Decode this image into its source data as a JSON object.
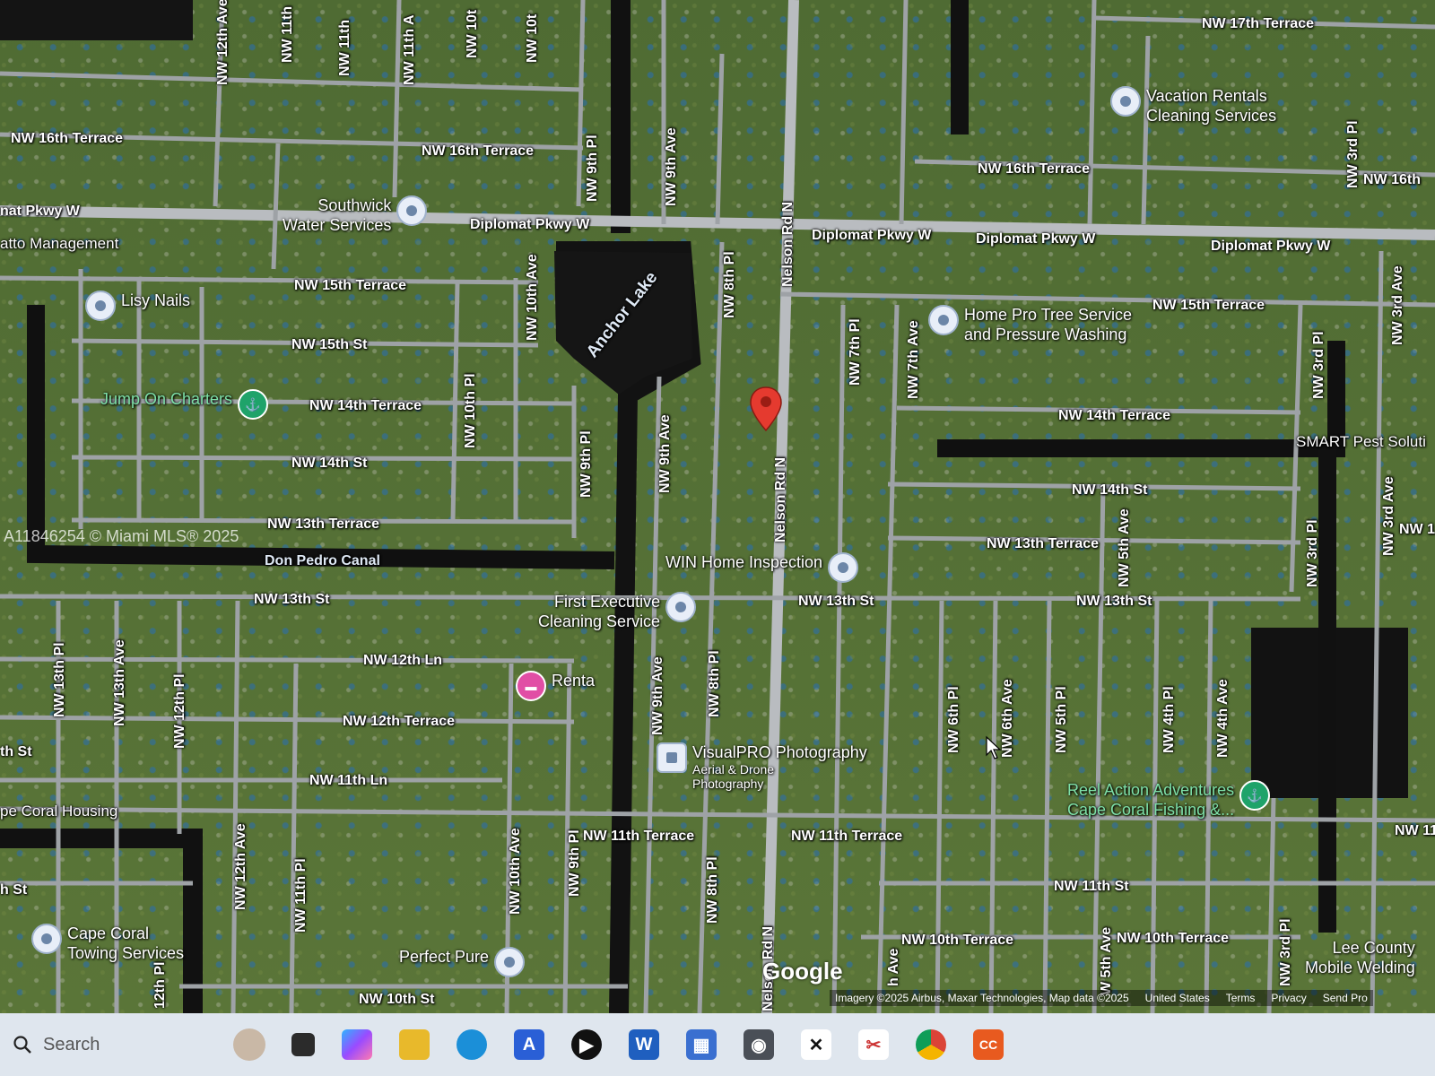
{
  "map": {
    "water": [
      {
        "name": "anchor-lake-label",
        "text": "Anchor Lake"
      },
      {
        "name": "don-pedro-canal-label",
        "text": "Don Pedro Canal"
      }
    ],
    "streets_h": [
      "NW 17th Terrace",
      "NW 16th Terrace",
      "NW 16th Terrace",
      "NW 16th Terrace",
      "NW 16th",
      "nat Pkwy W",
      "Diplomat Pkwy W",
      "Diplomat Pkwy W",
      "Diplomat Pkwy W",
      "Diplomat Pkwy W",
      "NW 15th Terrace",
      "NW 15th Terrace",
      "NW 15th St",
      "NW 14th Terrace",
      "NW 14th Terrace",
      "NW 14th St",
      "NW 14th St",
      "NW 13th Terrace",
      "NW 13th Terrace",
      "NW 13th St",
      "NW 13th St",
      "NW 13th St",
      "NW 12th Ln",
      "NW 12th Terrace",
      "NW 11th Ln",
      "NW 11th Terrace",
      "NW 11th Terrace",
      "NW 11th St",
      "NW 10th Terrace",
      "NW 10th Terrace",
      "NW 10th St",
      "th St",
      "h St",
      "NW 11",
      "NW 1"
    ],
    "streets_v": [
      "NW 12th Ave",
      "NW 11th",
      "NW 11th",
      "NW 11th A",
      "NW 10t",
      "NW 10t",
      "NW 9th Pl",
      "NW 9th Ave",
      "NW 8th Pl",
      "Nelson Rd N",
      "NW 10th Ave",
      "NW 10th Pl",
      "NW 9th Pl",
      "NW 9th Ave",
      "Nelson Rd N",
      "NW 7th Pl",
      "NW 7th Ave",
      "NW 3rd Pl",
      "NW 3rd Ave",
      "NW 3rd Pl",
      "NW 3rd Ave",
      "NW 5th Ave",
      "NW 3rd Pl",
      "NW 13th Pl",
      "NW 13th Ave",
      "NW 12th Pl",
      "NW 9th Ave",
      "NW 8th Pl",
      "NW 6th Pl",
      "NW 6th Ave",
      "NW 5th Pl",
      "NW 4th Pl",
      "NW 4th Ave",
      "NW 12th Ave",
      "NW 11th Pl",
      "NW 10th Ave",
      "NW 9th Pl",
      "NW 8th Pl",
      "Nelson Rd N",
      "h Ave",
      "W 5th Ave",
      "NW 3rd Pl",
      "12th Pl"
    ],
    "pois": [
      {
        "name": "vacation-rentals-poi",
        "title": "Vacation Rentals",
        "line2": "Cleaning Services",
        "kind": "default"
      },
      {
        "name": "southwick-poi",
        "title": "Southwick",
        "line2": "Water Services",
        "kind": "default"
      },
      {
        "name": "lisy-nails-poi",
        "title": "Lisy Nails",
        "line2": "",
        "kind": "default"
      },
      {
        "name": "home-pro-poi",
        "title": "Home Pro Tree Service",
        "line2": "and Pressure Washing",
        "kind": "default"
      },
      {
        "name": "jump-on-charters-poi",
        "title": "Jump On Charters",
        "line2": "",
        "kind": "green"
      },
      {
        "name": "win-home-poi",
        "title": "WIN Home Inspection",
        "line2": "",
        "kind": "default"
      },
      {
        "name": "first-executive-poi",
        "title": "First Executive",
        "line2": "Cleaning Service",
        "kind": "default"
      },
      {
        "name": "renta-poi",
        "title": "Renta",
        "line2": "",
        "kind": "pink"
      },
      {
        "name": "visualpro-poi",
        "title": "VisualPRO Photography",
        "line2": "Aerial & Drone",
        "line3": "Photography",
        "kind": "default"
      },
      {
        "name": "reel-action-poi",
        "title": "Reel Action Adventures",
        "line2": "Cape Coral Fishing &...",
        "kind": "green"
      },
      {
        "name": "cape-coral-towing-poi",
        "title": "Cape Coral",
        "line2": "Towing Services",
        "kind": "default"
      },
      {
        "name": "perfect-pure-poi",
        "title": "Perfect Pure",
        "line2": "",
        "kind": "default"
      },
      {
        "name": "lee-county-poi",
        "title": "Lee County",
        "line2": "Mobile Welding",
        "kind": "default"
      },
      {
        "name": "smart-pest-poi",
        "title": "SMART Pest Soluti",
        "line2": "",
        "kind": "none"
      },
      {
        "name": "atto-management-poi",
        "title": "atto Management",
        "line2": "",
        "kind": "none"
      },
      {
        "name": "cape-coral-housing-poi",
        "title": "pe Coral Housing",
        "line2": "",
        "kind": "none"
      }
    ],
    "watermark": "A11846254 © Miami MLS® 2025",
    "brand": "Google",
    "attribution": {
      "imagery": "Imagery ©2025 Airbus, Maxar Technologies, Map data ©2025",
      "country": "United States",
      "terms": "Terms",
      "privacy": "Privacy",
      "feedback": "Send Pro"
    }
  },
  "taskbar": {
    "search_placeholder": "Search",
    "apps": [
      "widgets",
      "copilot",
      "file-explorer",
      "edge",
      "app-a",
      "media-player",
      "word",
      "calculator",
      "camera",
      "capcut",
      "snipping-tool",
      "chrome",
      "app-cc"
    ],
    "colors": {
      "edge": "#1b8fd8",
      "word": "#1f5fbf",
      "chrome": "#2aa84a",
      "file-explorer": "#e8b92b",
      "app-a": "#2a5fd6",
      "calculator": "#3a6fd0",
      "app-cc": "#e85a1f",
      "copilot": "#7a5be6"
    }
  }
}
